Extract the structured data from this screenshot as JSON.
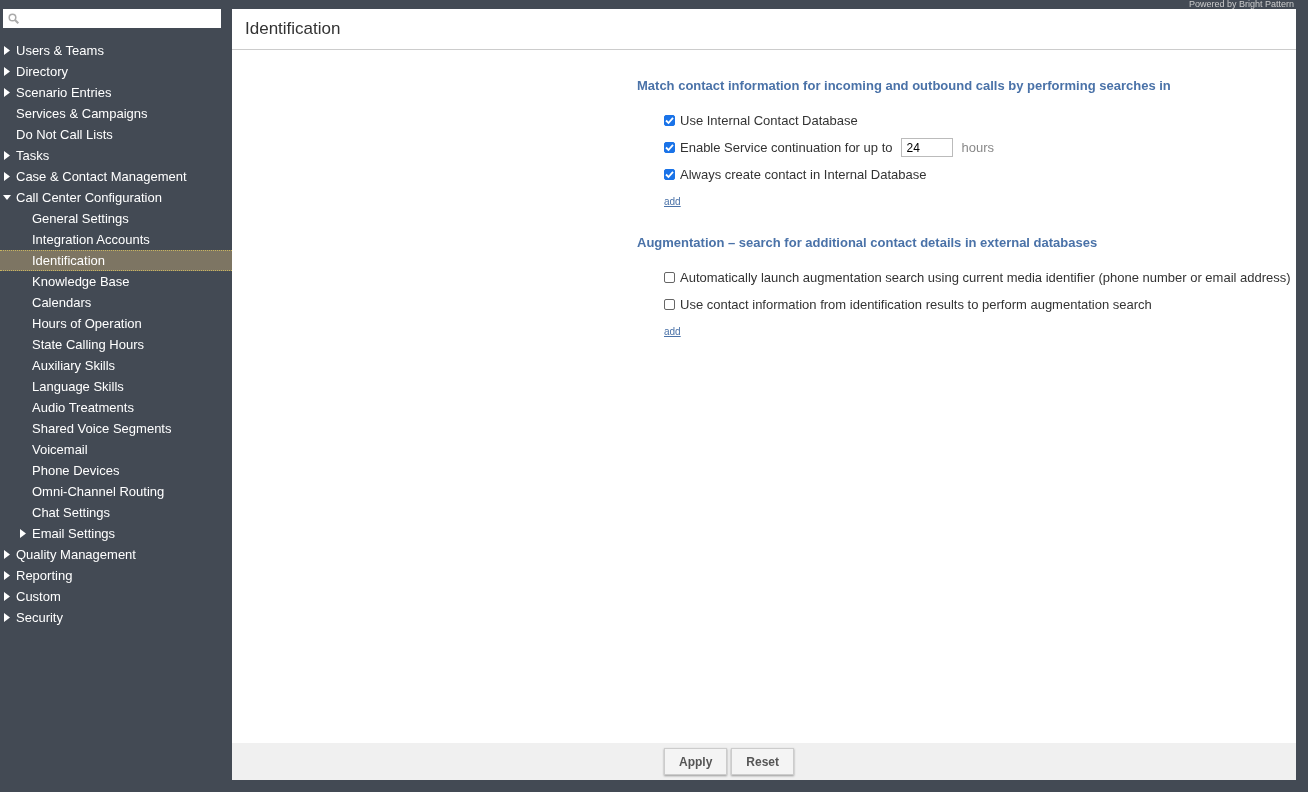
{
  "brand": "Powered by Bright Pattern",
  "sidebar": {
    "items": [
      {
        "label": "Users & Teams",
        "kind": "group",
        "expanded": false,
        "selected": false
      },
      {
        "label": "Directory",
        "kind": "group",
        "expanded": false,
        "selected": false
      },
      {
        "label": "Scenario Entries",
        "kind": "group",
        "expanded": false,
        "selected": false
      },
      {
        "label": "Services & Campaigns",
        "kind": "page",
        "selected": false
      },
      {
        "label": "Do Not Call Lists",
        "kind": "page",
        "selected": false
      },
      {
        "label": "Tasks",
        "kind": "group",
        "expanded": false,
        "selected": false
      },
      {
        "label": "Case & Contact Management",
        "kind": "group",
        "expanded": false,
        "selected": false
      },
      {
        "label": "Call Center Configuration",
        "kind": "group",
        "expanded": true,
        "selected": false,
        "children": [
          {
            "label": "General Settings",
            "kind": "page",
            "selected": false
          },
          {
            "label": "Integration Accounts",
            "kind": "page",
            "selected": false
          },
          {
            "label": "Identification",
            "kind": "page",
            "selected": true
          },
          {
            "label": "Knowledge Base",
            "kind": "page",
            "selected": false
          },
          {
            "label": "Calendars",
            "kind": "page",
            "selected": false
          },
          {
            "label": "Hours of Operation",
            "kind": "page",
            "selected": false
          },
          {
            "label": "State Calling Hours",
            "kind": "page",
            "selected": false
          },
          {
            "label": "Auxiliary Skills",
            "kind": "page",
            "selected": false
          },
          {
            "label": "Language Skills",
            "kind": "page",
            "selected": false
          },
          {
            "label": "Audio Treatments",
            "kind": "page",
            "selected": false
          },
          {
            "label": "Shared Voice Segments",
            "kind": "page",
            "selected": false
          },
          {
            "label": "Voicemail",
            "kind": "page",
            "selected": false
          },
          {
            "label": "Phone Devices",
            "kind": "page",
            "selected": false
          },
          {
            "label": "Omni-Channel Routing",
            "kind": "page",
            "selected": false
          },
          {
            "label": "Chat Settings",
            "kind": "page",
            "selected": false
          },
          {
            "label": "Email Settings",
            "kind": "group",
            "expanded": false,
            "selected": false
          }
        ]
      },
      {
        "label": "Quality Management",
        "kind": "group",
        "expanded": false,
        "selected": false
      },
      {
        "label": "Reporting",
        "kind": "group",
        "expanded": false,
        "selected": false
      },
      {
        "label": "Custom",
        "kind": "group",
        "expanded": false,
        "selected": false
      },
      {
        "label": "Security",
        "kind": "group",
        "expanded": false,
        "selected": false
      }
    ]
  },
  "page": {
    "title": "Identification",
    "sections": [
      {
        "heading": "Match contact information for incoming and outbound calls by performing searches in",
        "options": [
          {
            "kind": "checkbox",
            "label": "Use Internal Contact Database",
            "checked": true
          },
          {
            "kind": "checkbox_input",
            "label": "Enable Service continuation for up to",
            "checked": true,
            "value": "24",
            "unit": "hours"
          },
          {
            "kind": "checkbox",
            "label": "Always create contact in Internal Database",
            "checked": true
          }
        ],
        "link": "add"
      },
      {
        "heading": "Augmentation – search for additional contact details in external databases",
        "options": [
          {
            "kind": "checkbox",
            "label": "Automatically launch augmentation search using current media identifier (phone number or email address)",
            "checked": false
          },
          {
            "kind": "checkbox",
            "label": "Use contact information from identification results to perform augmentation search",
            "checked": false
          }
        ],
        "link": "add"
      }
    ]
  },
  "footer": {
    "buttons": [
      "Apply",
      "Reset"
    ]
  }
}
